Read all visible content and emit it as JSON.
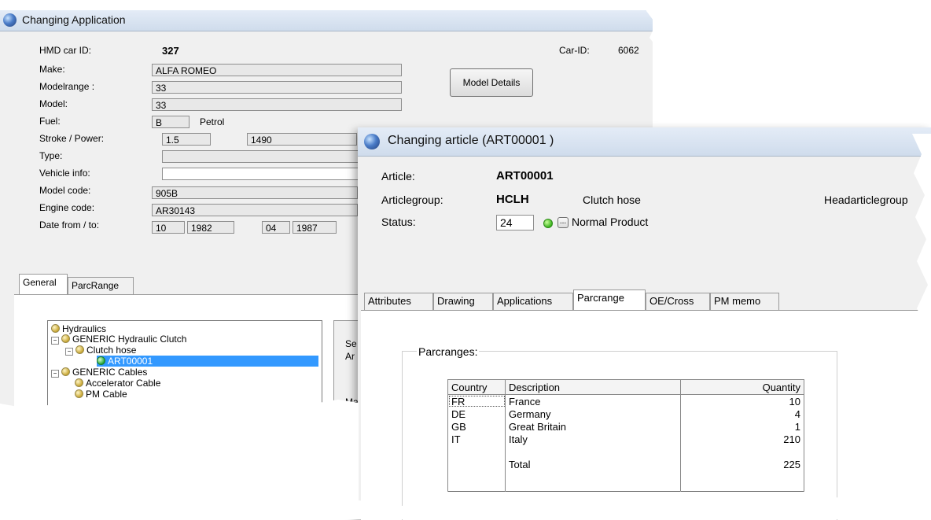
{
  "app_window": {
    "title": "Changing Application",
    "fields": {
      "hmd_car_id_label": "HMD car ID:",
      "hmd_car_id": "327",
      "car_id_label": "Car-ID:",
      "car_id": "6062",
      "make_label": "Make:",
      "make": "ALFA ROMEO",
      "modelrange_label": "Modelrange :",
      "modelrange": "33",
      "model_label": "Model:",
      "model": "33",
      "fuel_label": "Fuel:",
      "fuel_code": "B",
      "fuel_text": "Petrol",
      "stroke_label": "Stroke / Power:",
      "stroke": "1.5",
      "power": "1490",
      "type_label": "Type:",
      "type": "",
      "vehicle_info_label": "Vehicle info:",
      "vehicle_info": "",
      "model_code_label": "Model code:",
      "model_code": "905B",
      "engine_code_label": "Engine code:",
      "engine_code": "AR30143",
      "date_label": "Date from / to:",
      "date_from_month": "10",
      "date_from_year": "1982",
      "date_to_month": "04",
      "date_to_year": "1987"
    },
    "model_details_button": "Model Details",
    "tabs": [
      "General",
      "ParcRange"
    ],
    "tree": [
      "Hydraulics",
      "GENERIC Hydraulic Clutch",
      "Clutch hose",
      "ART00001",
      "GENERIC Cables",
      "Accelerator Cable",
      "PM Cable"
    ],
    "side_labels": [
      "Se",
      "Ar",
      "Ma"
    ]
  },
  "article_window": {
    "title": "Changing article  (ART00001      )",
    "article_label": "Article:",
    "article": "ART00001",
    "articlegroup_label": "Articlegroup:",
    "articlegroup_code": "HCLH",
    "articlegroup_desc": "Clutch hose",
    "headarticlegroup_label": "Headarticlegroup",
    "status_label": "Status:",
    "status_code": "24",
    "status_browse": "...",
    "status_text": "Normal Product",
    "tabs": [
      "Attributes",
      "Drawing",
      "Applications",
      "Parcrange",
      "OE/Cross",
      "PM memo"
    ],
    "parcranges_label": "Parcranges:",
    "table": {
      "headers": [
        "Country",
        "Description",
        "Quantity"
      ],
      "rows": [
        [
          "FR",
          "France",
          "10"
        ],
        [
          "DE",
          "Germany",
          "4"
        ],
        [
          "GB",
          "Great Britain",
          "1"
        ],
        [
          "IT",
          "Italy",
          "210"
        ],
        [
          "",
          "",
          ""
        ],
        [
          "",
          "Total",
          "225"
        ]
      ]
    }
  }
}
